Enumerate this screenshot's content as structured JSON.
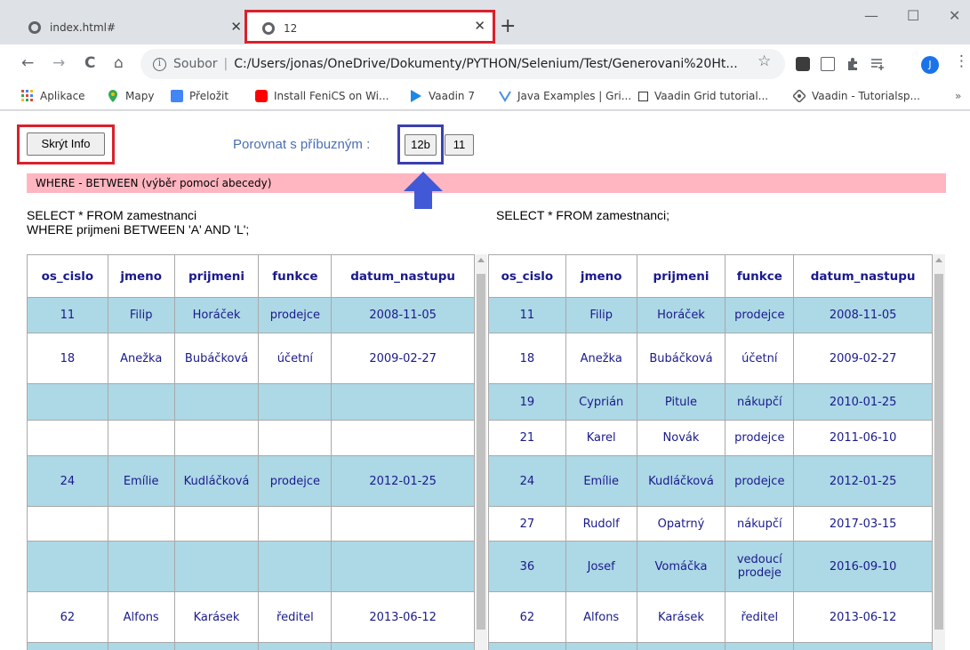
{
  "browser": {
    "tabs": [
      {
        "title": "index.html#",
        "close": "✕"
      },
      {
        "title": "12",
        "close": "✕"
      }
    ],
    "new_tab": "+",
    "window_controls": {
      "minimize": "—",
      "maximize": "☐",
      "close": "✕"
    },
    "nav": {
      "back": "←",
      "forward": "→",
      "reload": "C",
      "home": "⌂"
    },
    "address": {
      "scheme": "Soubor",
      "separator": "|",
      "url": "C:/Users/jonas/OneDrive/Dokumenty/PYTHON/Selenium/Test/Generovani%20Ht..."
    },
    "star": "☆",
    "menu": "⋮",
    "avatar_letter": "J",
    "bookmarks": [
      {
        "label": "Aplikace",
        "icon": "apps-grid-icon"
      },
      {
        "label": "Mapy",
        "icon": "maps-pin-icon"
      },
      {
        "label": "Přeložit",
        "icon": "translate-icon"
      },
      {
        "label": "Install FeniCS on Wi...",
        "icon": "youtube-icon"
      },
      {
        "label": "Vaadin 7",
        "icon": "play-icon"
      },
      {
        "label": "Java Examples | Gri...",
        "icon": "java-examples-icon"
      },
      {
        "label": "Vaadin Grid tutorial...",
        "icon": "square-icon"
      },
      {
        "label": "Vaadin - Tutorialsp...",
        "icon": "diamond-icon"
      }
    ],
    "bookmarks_more": "»"
  },
  "page": {
    "toggle_info_button": "Skrýt Info",
    "compare_label": "Porovnat s příbuzným :",
    "compare_buttons": [
      "12b",
      "11"
    ],
    "banner": "WHERE - BETWEEN (výběr pomocí abecedy)",
    "sql_left": "SELECT * FROM zamestnanci\nWHERE prijmeni BETWEEN 'A' AND 'L';",
    "sql_right": "SELECT * FROM zamestnanci;",
    "columns": [
      "os_cislo",
      "jmeno",
      "prijmeni",
      "funkce",
      "datum_nastupu"
    ],
    "left_rows": [
      [
        "11",
        "Filip",
        "Horáček",
        "prodejce",
        "2008-11-05"
      ],
      [
        "18",
        "Anežka",
        "Bubáčková",
        "účetní",
        "2009-02-27"
      ],
      [
        "",
        "",
        "",
        "",
        ""
      ],
      [
        "",
        "",
        "",
        "",
        ""
      ],
      [
        "24",
        "Emílie",
        "Kudláčková",
        "prodejce",
        "2012-01-25"
      ],
      [
        "",
        "",
        "",
        "",
        ""
      ],
      [
        "",
        "",
        "",
        "",
        ""
      ],
      [
        "62",
        "Alfons",
        "Karásek",
        "ředitel",
        "2013-06-12"
      ],
      [
        "",
        "",
        "",
        "",
        ""
      ]
    ],
    "right_rows": [
      [
        "11",
        "Filip",
        "Horáček",
        "prodejce",
        "2008-11-05"
      ],
      [
        "18",
        "Anežka",
        "Bubáčková",
        "účetní",
        "2009-02-27"
      ],
      [
        "19",
        "Cyprián",
        "Pitule",
        "nákupčí",
        "2010-01-25"
      ],
      [
        "21",
        "Karel",
        "Novák",
        "prodejce",
        "2011-06-10"
      ],
      [
        "24",
        "Emílie",
        "Kudláčková",
        "prodejce",
        "2012-01-25"
      ],
      [
        "27",
        "Rudolf",
        "Opatrný",
        "nákupčí",
        "2017-03-15"
      ],
      [
        "36",
        "Josef",
        "Vomáčka",
        "vedoucí prodeje",
        "2016-09-10"
      ],
      [
        "62",
        "Alfons",
        "Karásek",
        "ředitel",
        "2013-06-12"
      ],
      [
        "",
        "",
        "",
        "",
        ""
      ]
    ],
    "row_colors": [
      "#add8e6",
      "#ffffff"
    ],
    "highlight_colors": {
      "red": "#d9212b",
      "blue": "#3a3fb0",
      "banner": "#ffb6c1"
    }
  }
}
